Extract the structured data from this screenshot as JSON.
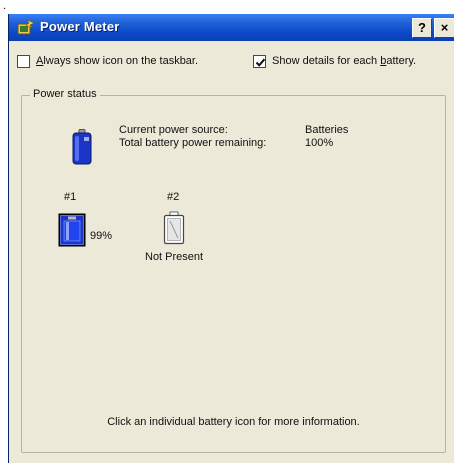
{
  "window": {
    "title": "Power Meter",
    "help_label": "?",
    "close_label": "×"
  },
  "options": {
    "always_show_icon": {
      "label_underlined": "A",
      "label_rest": "lways show icon on the taskbar.",
      "checked": false
    },
    "show_details": {
      "label_prefix": "Show details for each ",
      "label_underlined": "b",
      "label_rest": "attery.",
      "checked": true
    }
  },
  "power_status": {
    "legend": "Power status",
    "current_source_label": "Current power source:",
    "current_source_value": "Batteries",
    "remaining_label": "Total battery power remaining:",
    "remaining_value": "100%"
  },
  "batteries": [
    {
      "number": "#1",
      "percent_text": "99%",
      "level": 0.99,
      "present": true
    },
    {
      "number": "#2",
      "status_text": "Not Present",
      "present": false
    }
  ],
  "hint": "Click an individual battery icon for more information.",
  "colors": {
    "titlebar": "#0a49c9",
    "dialog_bg": "#ece9d8",
    "battery_blue": "#1a35c8"
  },
  "icons": {
    "title": "power-meter-icon",
    "main": "battery-icon",
    "battery1": "battery-full-icon",
    "battery2": "battery-empty-icon"
  }
}
